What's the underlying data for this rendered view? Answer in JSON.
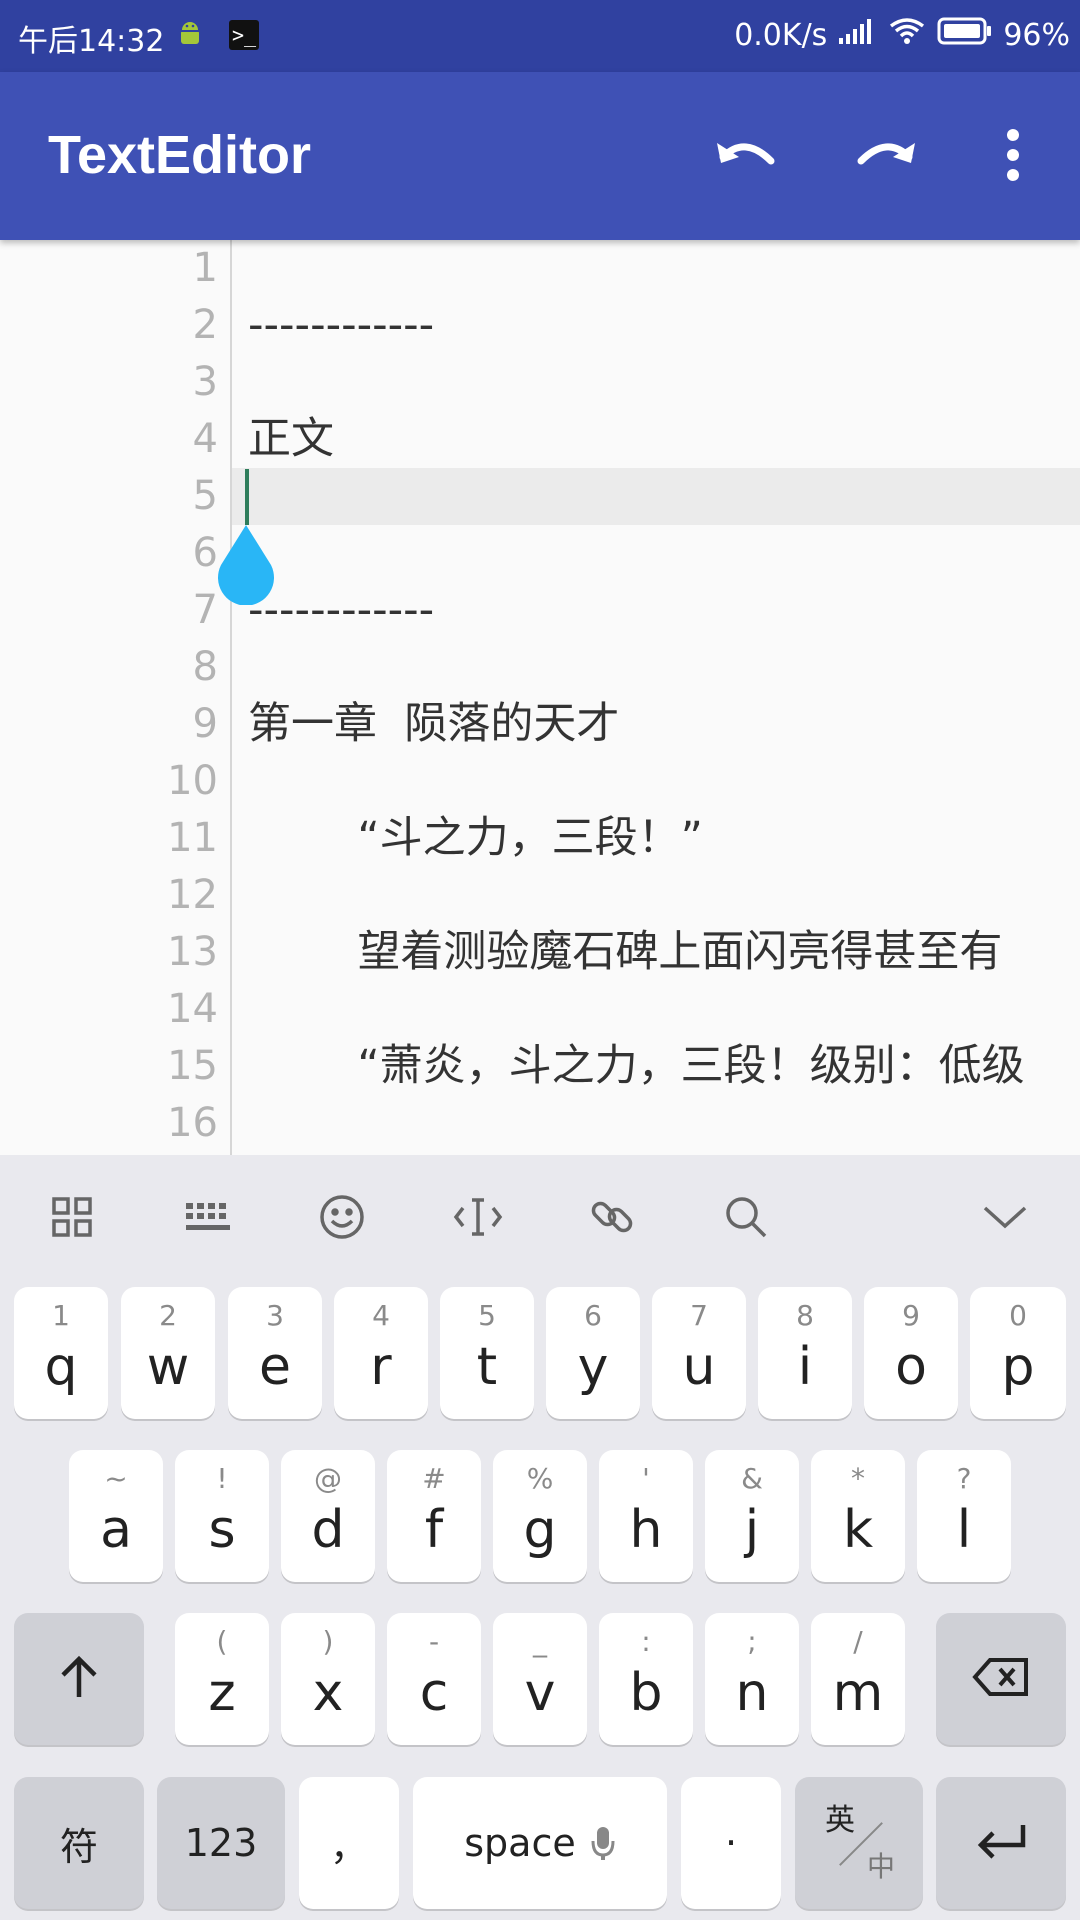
{
  "status": {
    "time": "午后14:32",
    "speed": "0.0K/s",
    "battery": "96%"
  },
  "appbar": {
    "title": "TextEditor",
    "icons": [
      "undo-icon",
      "redo-icon",
      "more-vert-icon"
    ]
  },
  "editor": {
    "lines": [
      {
        "num": "1",
        "text": ""
      },
      {
        "num": "2",
        "text": "------------"
      },
      {
        "num": "3",
        "text": ""
      },
      {
        "num": "4",
        "text": "正文"
      },
      {
        "num": "5",
        "text": ""
      },
      {
        "num": "6",
        "text": ""
      },
      {
        "num": "7",
        "text": "------------"
      },
      {
        "num": "8",
        "text": ""
      },
      {
        "num": "9",
        "text": "第一章  陨落的天才"
      },
      {
        "num": "10",
        "text": ""
      },
      {
        "num": "11",
        "text": "        “斗之力，三段！”"
      },
      {
        "num": "12",
        "text": ""
      },
      {
        "num": "13",
        "text": "        望着测验魔石碑上面闪亮得甚至有"
      },
      {
        "num": "14",
        "text": ""
      },
      {
        "num": "15",
        "text": "        “萧炎，斗之力，三段！级别：低级"
      },
      {
        "num": "16",
        "text": ""
      }
    ],
    "current_line": "5"
  },
  "keyboard": {
    "toolbar": [
      "grid-icon",
      "keyboard-icon",
      "emoji-icon",
      "cursor-icon",
      "link-icon",
      "search-icon",
      "collapse-icon"
    ],
    "row1": [
      {
        "sub": "1",
        "key": "q"
      },
      {
        "sub": "2",
        "key": "w"
      },
      {
        "sub": "3",
        "key": "e"
      },
      {
        "sub": "4",
        "key": "r"
      },
      {
        "sub": "5",
        "key": "t"
      },
      {
        "sub": "6",
        "key": "y"
      },
      {
        "sub": "7",
        "key": "u"
      },
      {
        "sub": "8",
        "key": "i"
      },
      {
        "sub": "9",
        "key": "o"
      },
      {
        "sub": "0",
        "key": "p"
      }
    ],
    "row2": [
      {
        "sub": "~",
        "key": "a"
      },
      {
        "sub": "!",
        "key": "s"
      },
      {
        "sub": "@",
        "key": "d"
      },
      {
        "sub": "#",
        "key": "f"
      },
      {
        "sub": "%",
        "key": "g"
      },
      {
        "sub": "'",
        "key": "h"
      },
      {
        "sub": "&",
        "key": "j"
      },
      {
        "sub": "*",
        "key": "k"
      },
      {
        "sub": "?",
        "key": "l"
      }
    ],
    "row3": [
      {
        "sub": "(",
        "key": "z"
      },
      {
        "sub": ")",
        "key": "x"
      },
      {
        "sub": "-",
        "key": "c"
      },
      {
        "sub": "_",
        "key": "v"
      },
      {
        "sub": ":",
        "key": "b"
      },
      {
        "sub": ";",
        "key": "n"
      },
      {
        "sub": "/",
        "key": "m"
      }
    ],
    "bottom": {
      "symbols": "符",
      "numbers": "123",
      "comma": "，",
      "space": "space",
      "period": "·",
      "lang_top": "英",
      "lang_bottom": "中"
    }
  }
}
